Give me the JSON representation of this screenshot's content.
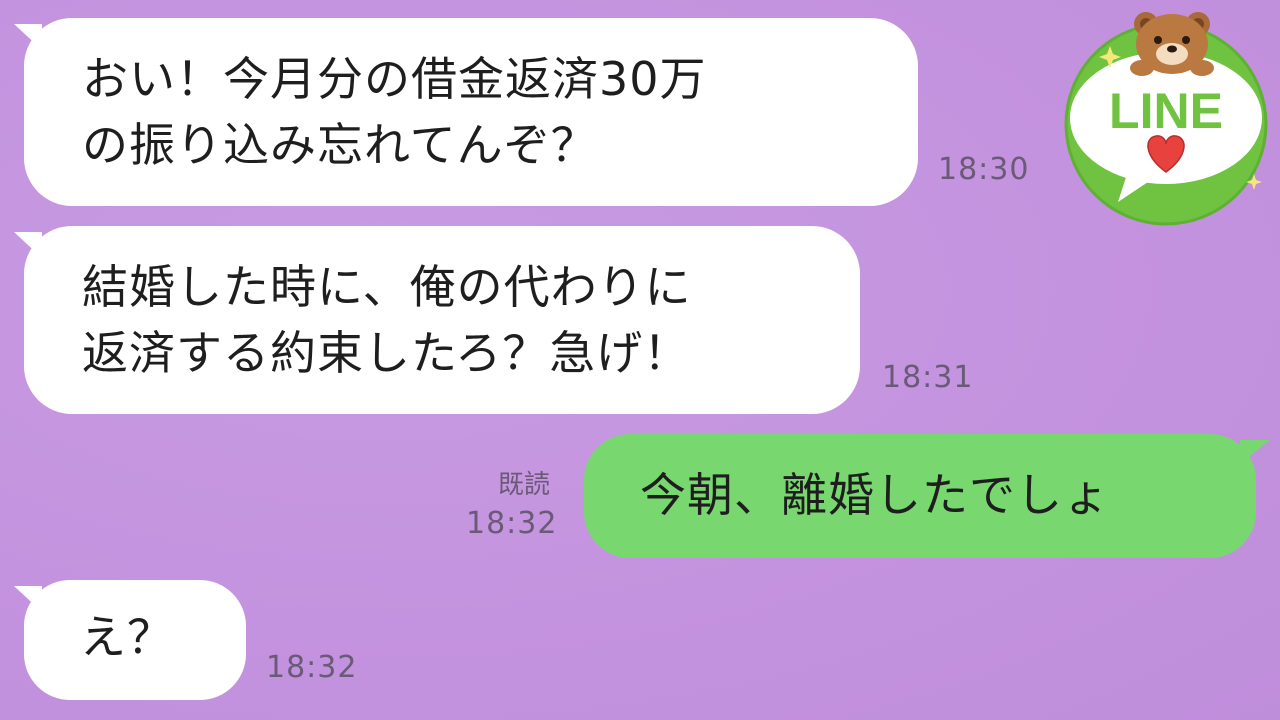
{
  "messages": [
    {
      "side": "in",
      "lines": [
        "おい！今月分の借金返済30万",
        "の振り込み忘れてんぞ？"
      ],
      "time": "18:30"
    },
    {
      "side": "in",
      "lines": [
        "結婚した時に、俺の代わりに",
        "返済する約束したろ？急げ！"
      ],
      "time": "18:31"
    },
    {
      "side": "out",
      "lines": [
        "今朝、離婚したでしょ"
      ],
      "read": "既読",
      "time": "18:32"
    },
    {
      "side": "in",
      "lines": [
        "え？"
      ],
      "time": "18:32"
    }
  ],
  "logo": {
    "text": "LINE",
    "icon": "bear-mascot-icon",
    "heart_icon": "heart-icon",
    "colors": {
      "ring": "#6fc340",
      "text": "#6fc340",
      "heart": "#e8423f",
      "bubble": "#ffffff"
    }
  },
  "colors": {
    "background": "#c595e1",
    "incoming_bubble": "#ffffff",
    "outgoing_bubble": "#78d86f"
  }
}
